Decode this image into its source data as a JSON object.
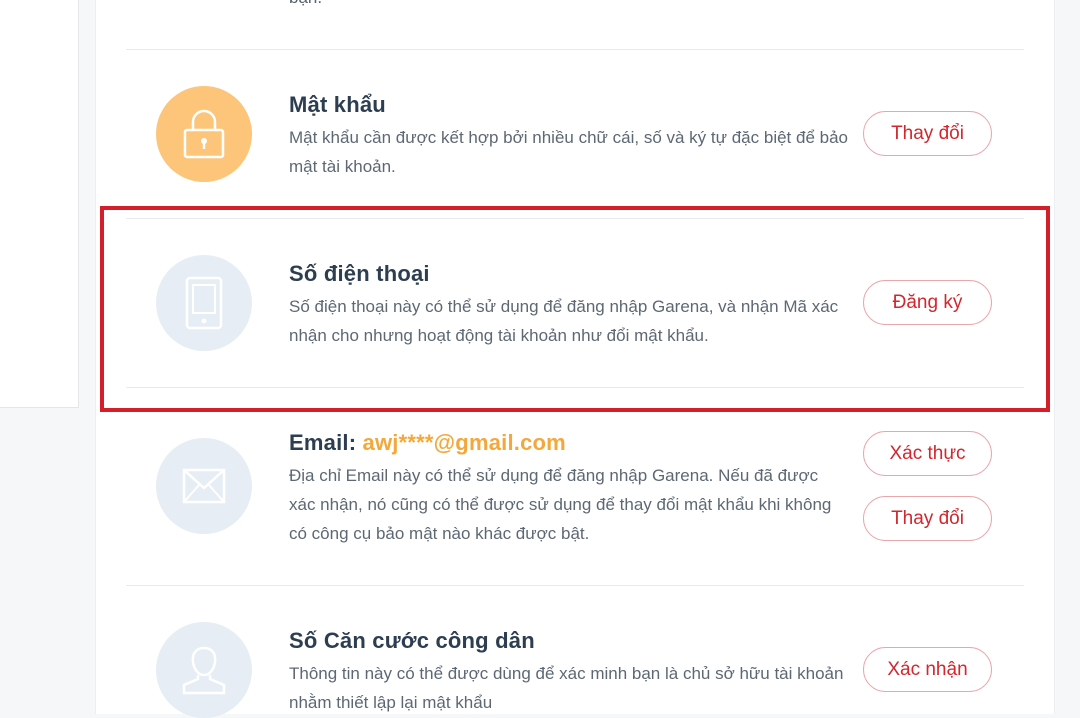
{
  "top_text": "bạn.",
  "sections": {
    "password": {
      "title": "Mật khẩu",
      "desc": "Mật khẩu cần được kết hợp bởi nhiều chữ cái, số và ký tự đặc biệt để bảo mật tài khoản.",
      "button": "Thay đổi",
      "icon": "lock-icon"
    },
    "phone": {
      "title": "Số điện thoại",
      "desc": "Số điện thoại này có thể sử dụng để đăng nhập Garena, và nhận Mã xác nhận cho nhưng hoạt động tài khoản như đổi mật khẩu.",
      "button": "Đăng ký",
      "icon": "phone-icon"
    },
    "email": {
      "title": "Email:",
      "value": "awj****@gmail.com",
      "desc": "Địa chỉ Email này có thể sử dụng để đăng nhập Garena. Nếu đã được xác nhận, nó cũng có thể được sử dụng để thay đổi mật khẩu khi không có công cụ bảo mật nào khác được bật.",
      "button_verify": "Xác thực",
      "button_change": "Thay đổi",
      "icon": "envelope-icon"
    },
    "id_card": {
      "title": "Số Căn cước công dân",
      "desc": "Thông tin này có thể được dùng để xác minh bạn là chủ sở hữu tài khoản nhằm thiết lập lại mật khẩu",
      "button": "Xác nhận",
      "icon": "user-icon"
    }
  },
  "colors": {
    "accent_red": "#d3262e",
    "highlight": "#d41f2b",
    "email_orange": "#f4a83b",
    "lock_circle": "#fcc57a"
  }
}
